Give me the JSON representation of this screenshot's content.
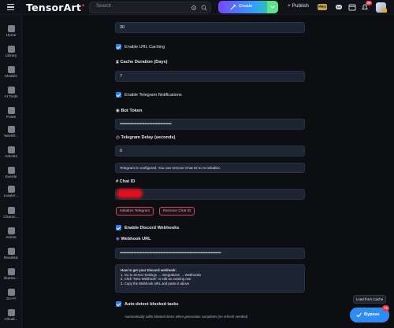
{
  "header": {
    "logo_text": "TensorArt",
    "search_placeholder": "Search",
    "create_label": "Create",
    "publish_label": "+ Publish",
    "pro_badge": "PRO",
    "notification_count": "29"
  },
  "sidebar": {
    "items": [
      {
        "label": "Home",
        "icon": "home-icon"
      },
      {
        "label": "Library",
        "icon": "library-icon"
      },
      {
        "label": "Models",
        "icon": "models-icon"
      },
      {
        "label": "AI Tools",
        "icon": "ai-tools-icon"
      },
      {
        "label": "Posts",
        "icon": "posts-icon"
      },
      {
        "label": "Workfl...",
        "icon": "workflow-icon"
      },
      {
        "label": "Articles",
        "icon": "articles-icon"
      },
      {
        "label": "Events",
        "icon": "events-icon"
      },
      {
        "label": "Leader...",
        "icon": "leaderboard-icon"
      },
      {
        "label": "Charac...",
        "icon": "characters-icon"
      },
      {
        "label": "Anime",
        "icon": "anime-icon"
      },
      {
        "label": "Realistic",
        "icon": "realistic-icon"
      },
      {
        "label": "Illustra...",
        "icon": "illustration-icon"
      },
      {
        "label": "Sci-Fi",
        "icon": "scifi-icon"
      },
      {
        "label": "Visual...",
        "icon": "visual-icon"
      }
    ]
  },
  "settings": {
    "top_value": "30",
    "enable_url_caching": "Enable URL Caching",
    "cache_duration_label": "Cache Duration (Days)",
    "cache_duration_value": "7",
    "enable_telegram": "Enable Telegram Notifications",
    "bot_token_label": "Bot Token",
    "bot_token_value": "••••••••••••••••••••••••••••••••••••••••••••••",
    "telegram_delay_label": "Telegram Delay (seconds)",
    "telegram_delay_value": "0",
    "telegram_status": "Telegram is configured. You can remove Chat ID to re-initialize.",
    "chat_id_label": "# Chat ID",
    "init_telegram_button": "Initialize Telegram",
    "remove_chat_button": "Remove Chat ID",
    "enable_discord": "Enable Discord Webhooks",
    "webhook_url_label": "Webhook URL",
    "webhook_url_value": "••••••••••••••••••••••••••••••••••••••••••••••••••••••••••••••••••••••••••••••••••••••••••",
    "howto": {
      "title": "How to get your Discord webhook:",
      "step1": "1. Go to Server Settings → Integrations → Webhooks",
      "step2": "2. Click \"New Webhook\" or edit an existing one",
      "step3": "3. Copy the Webhook URL and paste it above"
    },
    "auto_detect": "Auto-detect blocked tasks",
    "auto_detect_help": "Automatically adds blocked items when generation completes (no refresh needed)"
  },
  "toast": "Load from Cache",
  "buy_button": "Bypass",
  "buy_badge": "76"
}
